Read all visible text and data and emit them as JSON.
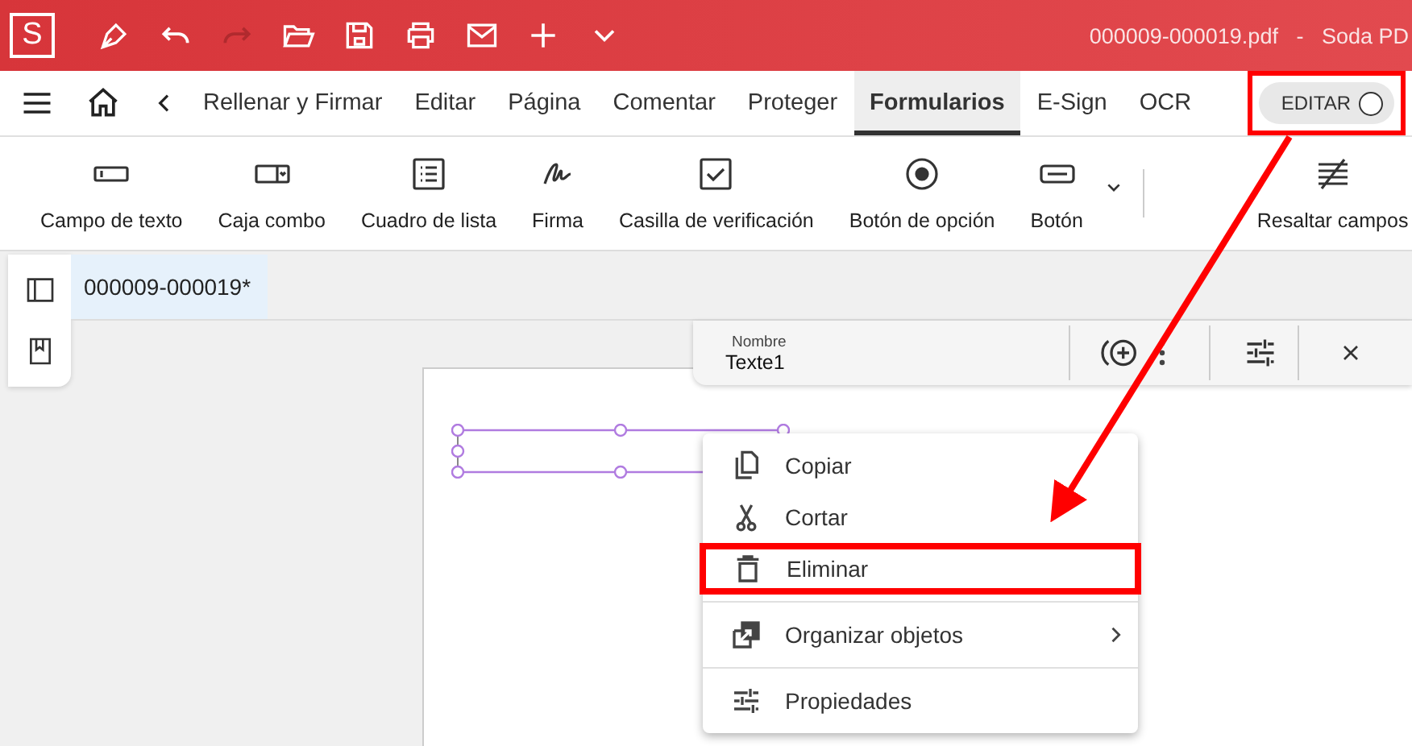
{
  "title_bar": {
    "logo": "S",
    "redo_disabled": true,
    "document_title": "000009-000019.pdf   -   Soda PD"
  },
  "tabs": [
    {
      "label": "Rellenar y Firmar",
      "selected": false
    },
    {
      "label": "Editar",
      "selected": false
    },
    {
      "label": "Página",
      "selected": false
    },
    {
      "label": "Comentar",
      "selected": false
    },
    {
      "label": "Proteger",
      "selected": false
    },
    {
      "label": "Formularios",
      "selected": true
    },
    {
      "label": "E-Sign",
      "selected": false
    },
    {
      "label": "OCR",
      "selected": false
    }
  ],
  "edit_toggle": {
    "label": "EDITAR",
    "on": false,
    "highlighted": true
  },
  "toolbar": [
    {
      "kind": "textfield",
      "label": "Campo de texto"
    },
    {
      "kind": "combo",
      "label": "Caja combo"
    },
    {
      "kind": "list",
      "label": "Cuadro de lista"
    },
    {
      "kind": "signature",
      "label": "Firma"
    },
    {
      "kind": "checkbox",
      "label": "Casilla de verificación"
    },
    {
      "kind": "radio",
      "label": "Botón de opción"
    },
    {
      "kind": "button",
      "label": "Botón"
    },
    {
      "kind": "highlight",
      "label": "Resaltar campos"
    }
  ],
  "document_tab": {
    "label": "000009-000019*"
  },
  "property_bar": {
    "label": "Nombre",
    "value": "Texte1"
  },
  "context_menu": [
    {
      "kind": "copy",
      "label": "Copiar",
      "highlighted": false,
      "submenu": false
    },
    {
      "kind": "cut",
      "label": "Cortar",
      "highlighted": false,
      "submenu": false
    },
    {
      "kind": "delete",
      "label": "Eliminar",
      "highlighted": true,
      "submenu": false
    },
    {
      "kind": "arrange",
      "label": "Organizar objetos",
      "highlighted": false,
      "submenu": true
    },
    {
      "kind": "properties",
      "label": "Propiedades",
      "highlighted": false,
      "submenu": false
    }
  ]
}
